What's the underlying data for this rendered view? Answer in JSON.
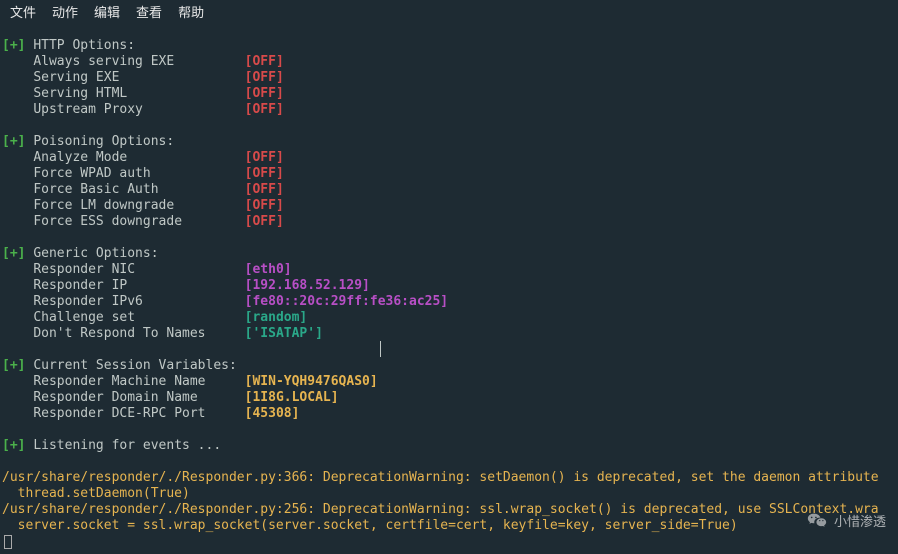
{
  "menubar": {
    "file": "文件",
    "actions": "动作",
    "edit": "编辑",
    "view": "查看",
    "help": "帮助"
  },
  "sections": {
    "http": {
      "title": "HTTP Options:",
      "items": [
        {
          "label": "Always serving EXE",
          "value": "[OFF]",
          "cls": "off"
        },
        {
          "label": "Serving EXE",
          "value": "[OFF]",
          "cls": "off"
        },
        {
          "label": "Serving HTML",
          "value": "[OFF]",
          "cls": "off"
        },
        {
          "label": "Upstream Proxy",
          "value": "[OFF]",
          "cls": "off"
        }
      ]
    },
    "poisoning": {
      "title": "Poisoning Options:",
      "items": [
        {
          "label": "Analyze Mode",
          "value": "[OFF]",
          "cls": "off"
        },
        {
          "label": "Force WPAD auth",
          "value": "[OFF]",
          "cls": "off"
        },
        {
          "label": "Force Basic Auth",
          "value": "[OFF]",
          "cls": "off"
        },
        {
          "label": "Force LM downgrade",
          "value": "[OFF]",
          "cls": "off"
        },
        {
          "label": "Force ESS downgrade",
          "value": "[OFF]",
          "cls": "off"
        }
      ]
    },
    "generic": {
      "title": "Generic Options:",
      "items": [
        {
          "label": "Responder NIC",
          "value": "[eth0]",
          "cls": "eth"
        },
        {
          "label": "Responder IP",
          "value": "[192.168.52.129]",
          "cls": "eth"
        },
        {
          "label": "Responder IPv6",
          "value": "[fe80::20c:29ff:fe36:ac25]",
          "cls": "eth"
        },
        {
          "label": "Challenge set",
          "value": "[random]",
          "cls": "cyan"
        },
        {
          "label": "Don't Respond To Names",
          "value": "['ISATAP']",
          "cls": "cyan"
        }
      ]
    },
    "session": {
      "title": "Current Session Variables:",
      "items": [
        {
          "label": "Responder Machine Name",
          "value": "[WIN-YQH9476QAS0]",
          "cls": "amb"
        },
        {
          "label": "Responder Domain Name",
          "value": "[1I8G.LOCAL]",
          "cls": "amb"
        },
        {
          "label": "Responder DCE-RPC Port",
          "value": "[45308]",
          "cls": "amb"
        }
      ]
    }
  },
  "listening": "Listening for events ...",
  "warnings": [
    "/usr/share/responder/./Responder.py:366: DeprecationWarning: setDaemon() is deprecated, set the daemon attribute ",
    "  thread.setDaemon(True)",
    "/usr/share/responder/./Responder.py:256: DeprecationWarning: ssl.wrap_socket() is deprecated, use SSLContext.wra",
    "  server.socket = ssl.wrap_socket(server.socket, certfile=cert, keyfile=key, server_side=True)"
  ],
  "watermark": {
    "text": "小惜渗透"
  }
}
